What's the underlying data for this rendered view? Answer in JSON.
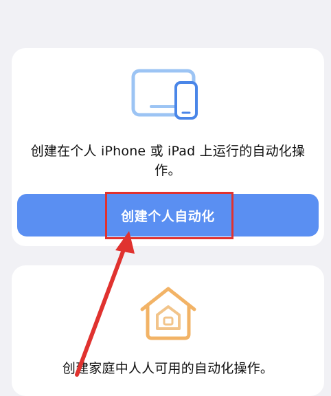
{
  "personal_card": {
    "description": "创建在个人 iPhone 或 iPad 上运行的自动化操作。",
    "button_label": "创建个人自动化",
    "icon": "devices-icon"
  },
  "home_card": {
    "description": "创建家庭中人人可用的自动化操作。",
    "icon": "home-icon"
  },
  "annotation": {
    "highlight_color": "#e0322f",
    "arrow_color": "#e0322f"
  },
  "colors": {
    "accent": "#5a8ff2",
    "background": "#f1f1f5",
    "home_icon": "#f2aa52"
  }
}
